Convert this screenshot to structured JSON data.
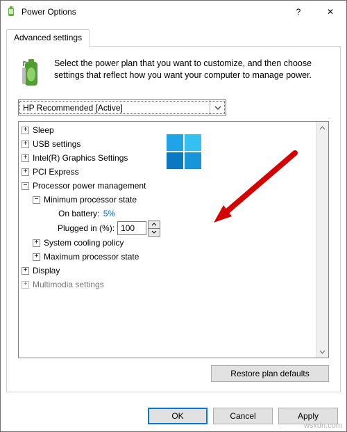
{
  "title": "Power Options",
  "tab": "Advanced settings",
  "intro": "Select the power plan that you want to customize, and then choose settings that reflect how you want your computer to manage power.",
  "plan_selected": "HP Recommended [Active]",
  "nodes": {
    "sleep": "Sleep",
    "usb": "USB settings",
    "intel": "Intel(R) Graphics Settings",
    "pci": "PCI Express",
    "ppm": "Processor power management",
    "min_state": "Minimum processor state",
    "on_battery_label": "On battery:",
    "on_battery_value": "5%",
    "plugged_label": "Plugged in (%):",
    "plugged_value": "100",
    "cooling": "System cooling policy",
    "max_state": "Maximum processor state",
    "display": "Display",
    "multimedia": "Multimodia settings"
  },
  "buttons": {
    "restore": "Restore plan defaults",
    "ok": "OK",
    "cancel": "Cancel",
    "apply": "Apply"
  },
  "help_glyph": "?",
  "close_glyph": "✕",
  "watermark": "wsxdn.com"
}
